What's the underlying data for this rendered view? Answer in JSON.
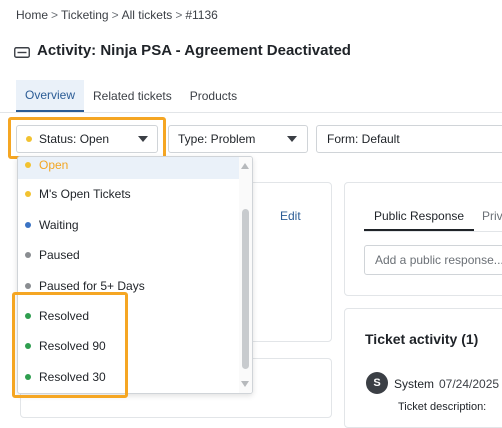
{
  "breadcrumb": [
    "Home",
    "Ticketing",
    "All tickets",
    "#1136"
  ],
  "breadcrumb_separator": ">",
  "title": "Activity: Ninja PSA - Agreement Deactivated",
  "tabs": [
    {
      "label": "Overview",
      "active": true
    },
    {
      "label": "Related tickets",
      "active": false
    },
    {
      "label": "Products",
      "active": false
    }
  ],
  "filters": {
    "status": {
      "label": "Status: Open",
      "dot_color": "#f2c230"
    },
    "type": {
      "label": "Type: Problem"
    },
    "form": {
      "label": "Form: Default"
    }
  },
  "status_options": [
    {
      "label": "Open",
      "dot_color": "#f2c230",
      "selected": true
    },
    {
      "label": "M's Open Tickets",
      "dot_color": "#f2c230",
      "selected": false
    },
    {
      "label": "Waiting",
      "dot_color": "#3a73c4",
      "selected": false
    },
    {
      "label": "Paused",
      "dot_color": "#8a8d91",
      "selected": false
    },
    {
      "label": "Paused for 5+ Days",
      "dot_color": "#8a8d91",
      "selected": false
    },
    {
      "label": "Resolved",
      "dot_color": "#2e9e4f",
      "selected": false
    },
    {
      "label": "Resolved 90",
      "dot_color": "#2e9e4f",
      "selected": false
    },
    {
      "label": "Resolved 30",
      "dot_color": "#2e9e4f",
      "selected": false
    }
  ],
  "details_panel": {
    "edit_label": "Edit"
  },
  "response_panel": {
    "tabs": [
      "Public Response",
      "Priv"
    ],
    "placeholder": "Add a public response..."
  },
  "activity_panel": {
    "title": "Ticket activity (1)",
    "entry": {
      "avatar_initial": "S",
      "author": "System",
      "date": "07/24/2025",
      "body": "Ticket description:"
    }
  },
  "colors": {
    "accent": "#2b5c95",
    "highlight": "#f5a623"
  }
}
